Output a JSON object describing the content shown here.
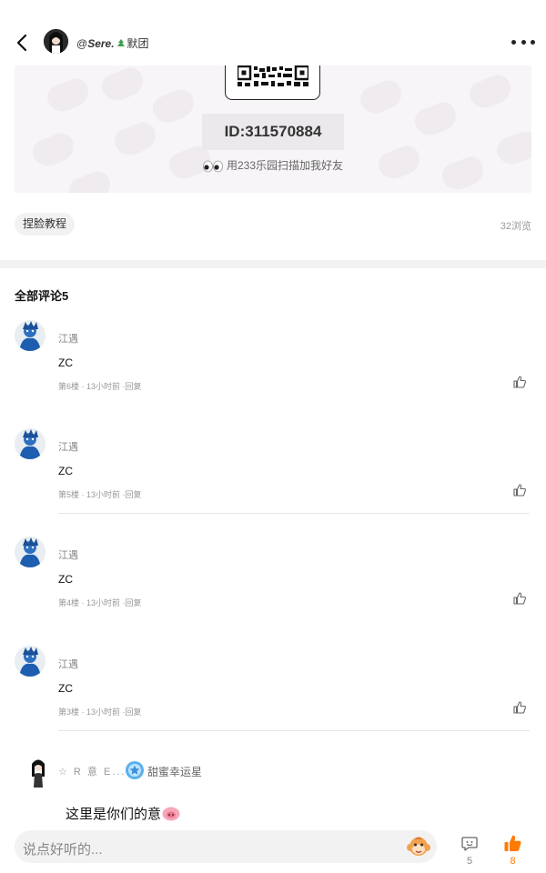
{
  "header": {
    "author_prefix": "@",
    "author_name": "Sere.",
    "author_suffix": "默团",
    "back_icon": "chevron-left-icon",
    "more_icon": "more-dots-icon"
  },
  "banner": {
    "id_text": "ID:311570884",
    "scan_tip": "用233乐园扫描加我好友"
  },
  "post": {
    "tag": "捏脸教程",
    "views": "32浏览"
  },
  "comments_title": "全部评论5",
  "comments": [
    {
      "name": "江遇",
      "text": "ZC",
      "meta": "第6楼 · 13小时前 ·回复"
    },
    {
      "name": "江遇",
      "text": "ZC",
      "meta": "第5楼 · 13小时前 ·回复"
    },
    {
      "name": "江遇",
      "text": "ZC",
      "meta": "第4楼 · 13小时前 ·回复"
    },
    {
      "name": "江遇",
      "text": "ZC",
      "meta": "第3楼 · 13小时前 ·回复"
    }
  ],
  "last_comment": {
    "name": "☆ R 意 E...",
    "badge": "甜蜜幸运星",
    "text": "这里是你们的意"
  },
  "bottom_bar": {
    "placeholder": "说点好听的...",
    "comment_count": "5",
    "like_count": "8"
  },
  "colors": {
    "accent": "#ff7a00",
    "divider": "#e6e6e6",
    "chip_bg": "#f2f2f2"
  }
}
